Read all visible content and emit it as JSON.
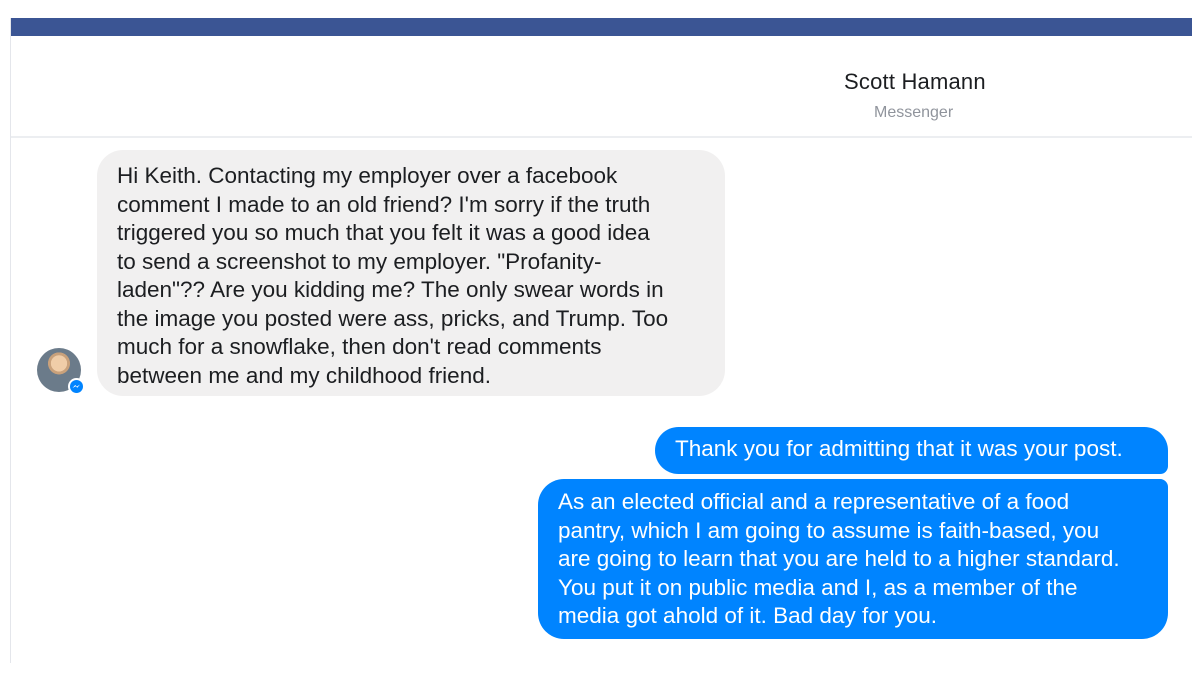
{
  "header": {
    "contact_name": "Scott Hamann",
    "subtitle": "Messenger"
  },
  "colors": {
    "top_bar": "#3b5594",
    "incoming_bubble": "#f1f0f0",
    "outgoing_bubble": "#0084ff"
  },
  "messages": [
    {
      "direction": "incoming",
      "text": "Hi Keith. Contacting my employer over a facebook\ncomment I made to an old friend?  I'm sorry if the truth\ntriggered you so much that you felt it was a good idea\nto send a screenshot to my employer.  \"Profanity-\nladen\"?? Are you kidding me?  The only swear words in\nthe image you posted were ass, pricks, and Trump.  Too\nmuch for a snowflake, then don't read comments\nbetween me and my childhood friend."
    },
    {
      "direction": "outgoing",
      "text": "Thank you for admitting that it was your post."
    },
    {
      "direction": "outgoing",
      "text": "As an elected official and a representative of a food\npantry, which I am going to assume is faith-based, you\nare going to learn that you are held to a higher standard.\nYou put it on public media and I, as a member of the\nmedia got ahold of it.  Bad day for you."
    }
  ],
  "sender_avatar": {
    "icon": "messenger-badge-icon"
  }
}
